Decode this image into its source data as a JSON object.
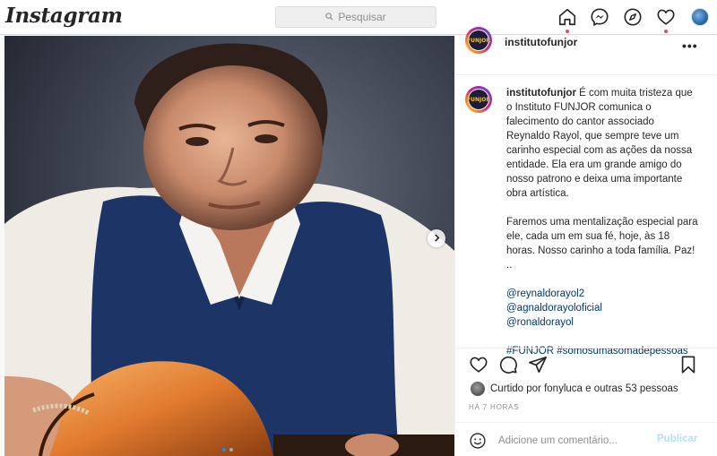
{
  "app": {
    "logo_text": "Instagram",
    "accent_color": "#0095f6",
    "notification_color": "#ed4956"
  },
  "search": {
    "placeholder": "Pesquisar",
    "icon": "search-icon"
  },
  "nav": {
    "icons": [
      "home-icon",
      "messenger-icon",
      "explore-icon",
      "heart-icon",
      "profile-avatar"
    ]
  },
  "post": {
    "username": "institutofunjor",
    "avatar_text": "FUNJOR",
    "caption": {
      "intro": "É com muita tristeza que o Instituto FUNJOR comunica o falecimento do cantor associado Reynaldo Rayol, que sempre teve um carinho especial com as ações da nossa entidade. Ela era um grande amigo do nosso patrono e deixa uma importante obra artística.",
      "paragraph2": "Faremos uma mentalização especial para ele, cada um em sua fé, hoje, às 18 horas. Nosso carinho a toda família. Paz! ..",
      "mentions": [
        "@reynaldorayol2",
        "@agnaldorayoloficial",
        "@ronaldorayol"
      ],
      "hashtags": "#FUNJOR #somosumasomadepessoas"
    },
    "likes_text": "Curtido por fonyluca e outras 53 pessoas",
    "timestamp": "HÁ 7 HORAS",
    "comment_placeholder": "Adicione um comentário...",
    "publish_label": "Publicar",
    "carousel": {
      "count": 2,
      "active": 1
    }
  }
}
